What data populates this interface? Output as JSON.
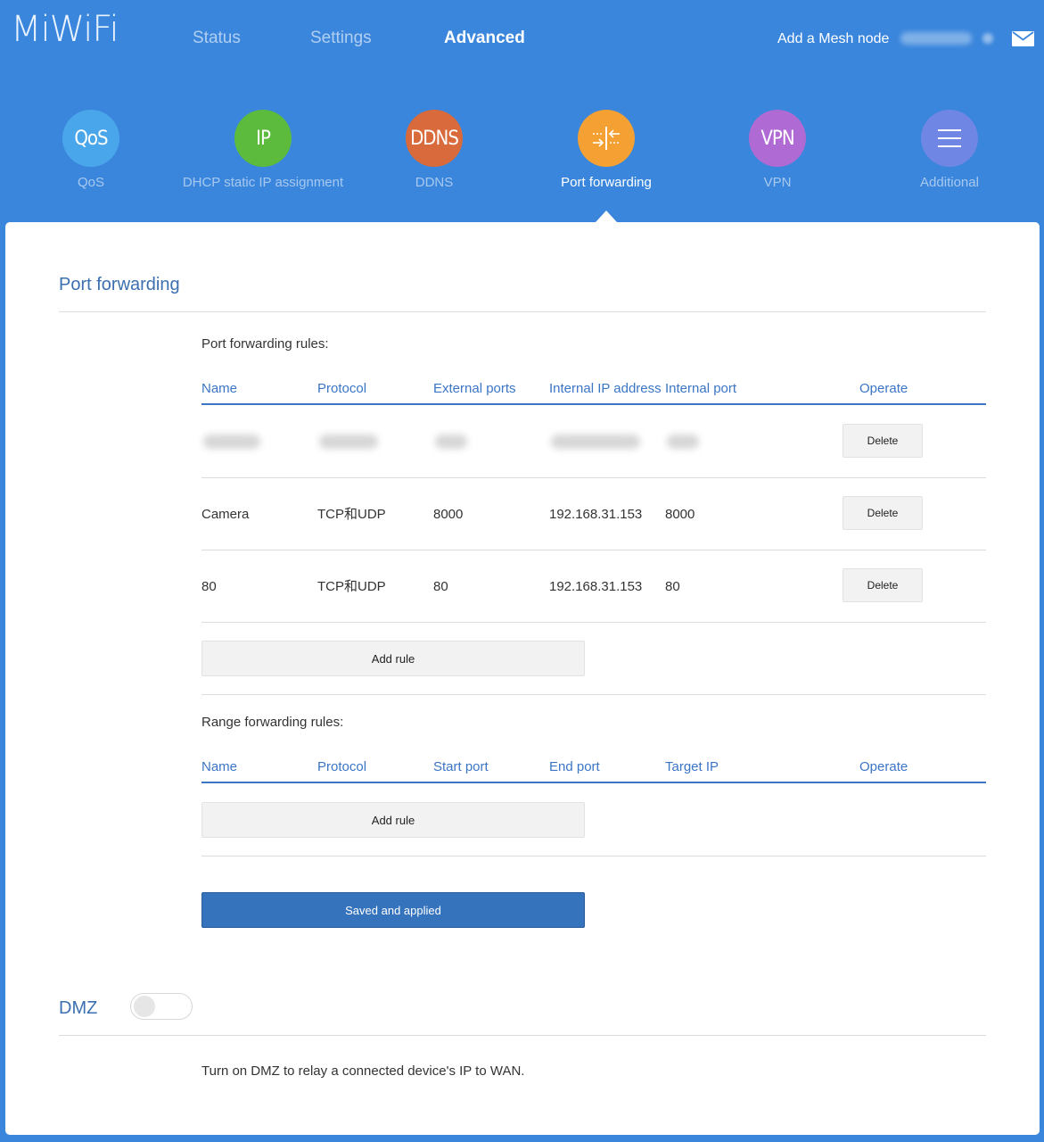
{
  "header": {
    "logo": "MiWiFi",
    "nav": [
      "Status",
      "Settings",
      "Advanced"
    ],
    "active_nav": "Advanced",
    "add_mesh_node": "Add a Mesh node"
  },
  "features": [
    {
      "icon_text": "QoS",
      "label": "QoS",
      "color": "#4aa6ea"
    },
    {
      "icon_text": "IP",
      "label": "DHCP static IP assignment",
      "color": "#5cbb3c"
    },
    {
      "icon_text": "DDNS",
      "label": "DDNS",
      "color": "#d96a3b"
    },
    {
      "icon_text": "",
      "label": "Port forwarding",
      "color": "#f4a032",
      "icon": "port-forwarding-icon"
    },
    {
      "icon_text": "VPN",
      "label": "VPN",
      "color": "#b06ad4"
    },
    {
      "icon_text": "",
      "label": "Additional",
      "color": "#6f86e4",
      "icon": "menu-icon"
    }
  ],
  "port_forwarding": {
    "title": "Port forwarding",
    "rules_heading": "Port forwarding rules:",
    "columns": [
      "Name",
      "Protocol",
      "External ports",
      "Internal IP address",
      "Internal port",
      "Operate"
    ],
    "rows": [
      {
        "name": "",
        "protocol": "",
        "external_ports": "",
        "internal_ip": "",
        "internal_port": "",
        "blurred": true,
        "action": "Delete"
      },
      {
        "name": "Camera",
        "protocol": "TCP和UDP",
        "external_ports": "8000",
        "internal_ip": "192.168.31.153",
        "internal_port": "8000",
        "action": "Delete"
      },
      {
        "name": "80",
        "protocol": "TCP和UDP",
        "external_ports": "80",
        "internal_ip": "192.168.31.153",
        "internal_port": "80",
        "action": "Delete"
      }
    ],
    "add_rule": "Add rule",
    "range_heading": "Range forwarding rules:",
    "range_columns": [
      "Name",
      "Protocol",
      "Start port",
      "End port",
      "Target IP",
      "Operate"
    ],
    "range_add_rule": "Add rule",
    "save_button": "Saved and applied"
  },
  "dmz": {
    "title": "DMZ",
    "enabled": false,
    "description": "Turn on DMZ to relay a connected device's IP to WAN."
  }
}
